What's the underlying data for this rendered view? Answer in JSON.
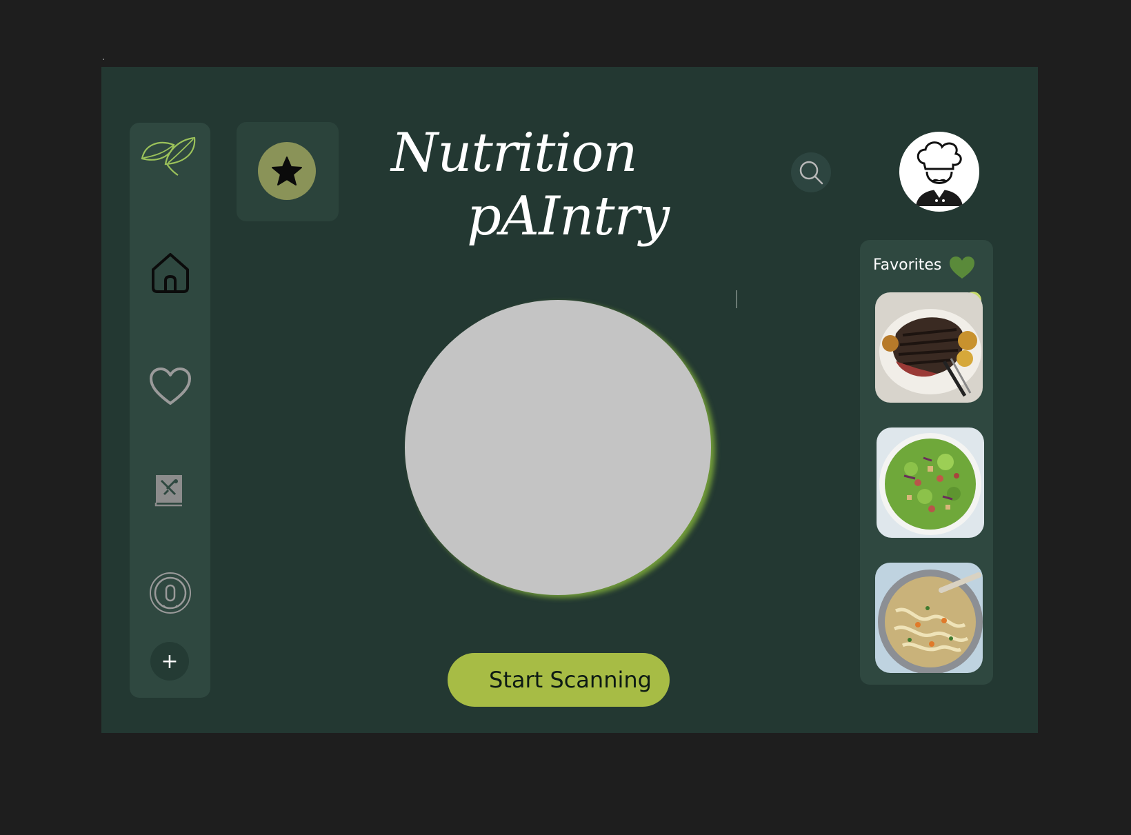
{
  "app": {
    "title_line1": "Nutrition",
    "title_line2": "pAIntry"
  },
  "sidebar": {
    "items": [
      {
        "name": "logo",
        "icon": "leaf-icon"
      },
      {
        "name": "home",
        "icon": "home-icon"
      },
      {
        "name": "favorites",
        "icon": "heart-icon"
      },
      {
        "name": "recipes",
        "icon": "recipe-book-icon"
      },
      {
        "name": "timer",
        "icon": "timer-icon"
      },
      {
        "name": "add",
        "icon": "plus-icon",
        "label": "+"
      }
    ]
  },
  "header": {
    "star_icon": "star-icon",
    "search_icon": "search-icon",
    "avatar_icon": "chef-avatar-icon"
  },
  "main": {
    "scan_button_label": "Start Scanning"
  },
  "favorites": {
    "title": "Favorites",
    "icon": "heart-icon",
    "items": [
      {
        "name": "grilled steak",
        "icon": "steak-image"
      },
      {
        "name": "green salad",
        "icon": "salad-image"
      },
      {
        "name": "noodle soup",
        "icon": "soup-image"
      }
    ]
  },
  "colors": {
    "background": "#1e1e1e",
    "frame": "#233832",
    "panel": "#2f4840",
    "accent": "#a7bc45",
    "star_circle": "#8a9358",
    "fav_heart": "#5a8a3a",
    "scan_circle": "#c4c4c4"
  }
}
